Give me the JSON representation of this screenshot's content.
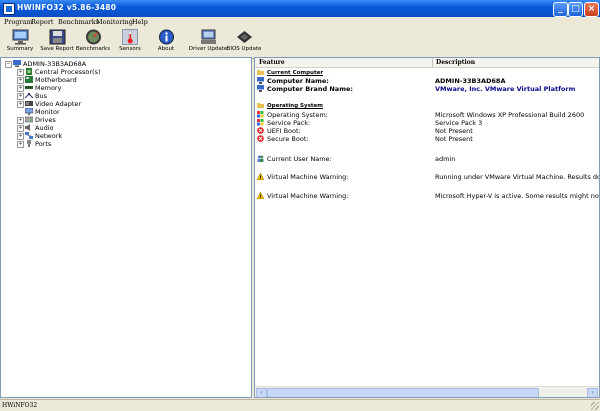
{
  "window": {
    "title": "HWiNFO32 v5.86-3480",
    "min": "_",
    "max": "□",
    "close": "×"
  },
  "menu": [
    "Program",
    "Report",
    "Benchmarks",
    "Monitoring",
    "Help"
  ],
  "toolbar": [
    {
      "label": "Summary",
      "icon": "monitor-icon"
    },
    {
      "label": "Save Report",
      "icon": "floppy-disk-icon"
    },
    {
      "label": "Benchmarks",
      "icon": "gauge-icon"
    },
    {
      "label": "Sensors",
      "icon": "thermometer-icon"
    },
    {
      "label": "About",
      "icon": "info-icon"
    },
    {
      "label": "Driver Update",
      "icon": "driver-update-icon"
    },
    {
      "label": "BIOS Update",
      "icon": "chip-icon"
    }
  ],
  "tree": {
    "root": "ADMIN-33B3AD68A",
    "items": [
      "Central Processor(s)",
      "Motherboard",
      "Memory",
      "Bus",
      "Video Adapter",
      "Monitor",
      "Drives",
      "Audio",
      "Network",
      "Ports"
    ]
  },
  "detail": {
    "columns": {
      "feature": "Feature",
      "description": "Description"
    },
    "rows": [
      {
        "feature": "Current Computer",
        "description": ""
      },
      {
        "feature": "Computer Name:",
        "description": "ADMIN-33B3AD68A"
      },
      {
        "feature": "Computer Brand Name:",
        "description": "VMware, Inc. VMware Virtual Platform"
      },
      {
        "feature": "Operating System",
        "description": ""
      },
      {
        "feature": "Operating System:",
        "description": "Microsoft Windows XP Professional Build 2600"
      },
      {
        "feature": "Service Pack:",
        "description": "Service Pack 3"
      },
      {
        "feature": "UEFI Boot:",
        "description": "Not Present"
      },
      {
        "feature": "Secure Boot:",
        "description": "Not Present"
      },
      {
        "feature": "Current User Name:",
        "description": "admin"
      },
      {
        "feature": "Virtual Machine Warning:",
        "description": "Running under VMware Virtual Machine. Results do not re"
      },
      {
        "feature": "Virtual Machine Warning:",
        "description": "Microsoft Hyper-V is active. Some results might not reflec"
      }
    ]
  },
  "status": "HWiNFO32"
}
